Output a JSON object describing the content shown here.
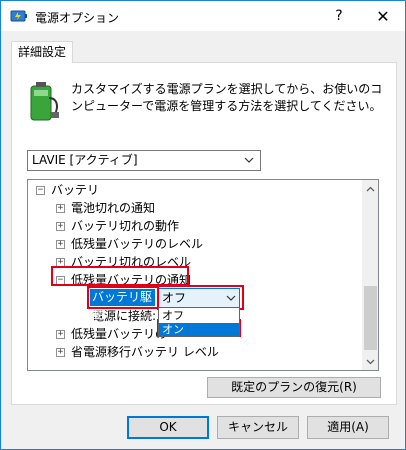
{
  "window": {
    "title": "電源オプション",
    "help": "?",
    "close": "✕"
  },
  "tab": {
    "label": "詳細設定"
  },
  "description": "カスタマイズする電源プランを選択してから、お使いのコンピューターで電源を管理する方法を選択してください。",
  "plan_select": {
    "value": "LAVIE [アクティブ]"
  },
  "tree": {
    "items": [
      {
        "label": "バッテリ",
        "expander": "−"
      },
      {
        "label": "電池切れの通知",
        "expander": "+"
      },
      {
        "label": "バッテリ切れの動作",
        "expander": "+"
      },
      {
        "label": "低残量バッテリのレベル",
        "expander": "+"
      },
      {
        "label": "バッテリ切れのレベル",
        "expander": "+"
      },
      {
        "label": "低残量バッテリの通知",
        "expander": "−"
      },
      {
        "label": "バッテリ駆動:"
      },
      {
        "label": "電源に接続:"
      },
      {
        "label": "低残量バッテリの",
        "expander": "+"
      },
      {
        "label": "省電源移行バッテリ レベル",
        "expander": "+"
      }
    ],
    "battery_value": "オフ",
    "options": [
      "オフ",
      "オン"
    ]
  },
  "buttons": {
    "restore": "既定のプランの復元(R)",
    "ok": "OK",
    "cancel": "キャンセル",
    "apply": "適用(A)"
  },
  "colors": {
    "highlight": "#0078d7",
    "annotation": "#e0001a"
  }
}
